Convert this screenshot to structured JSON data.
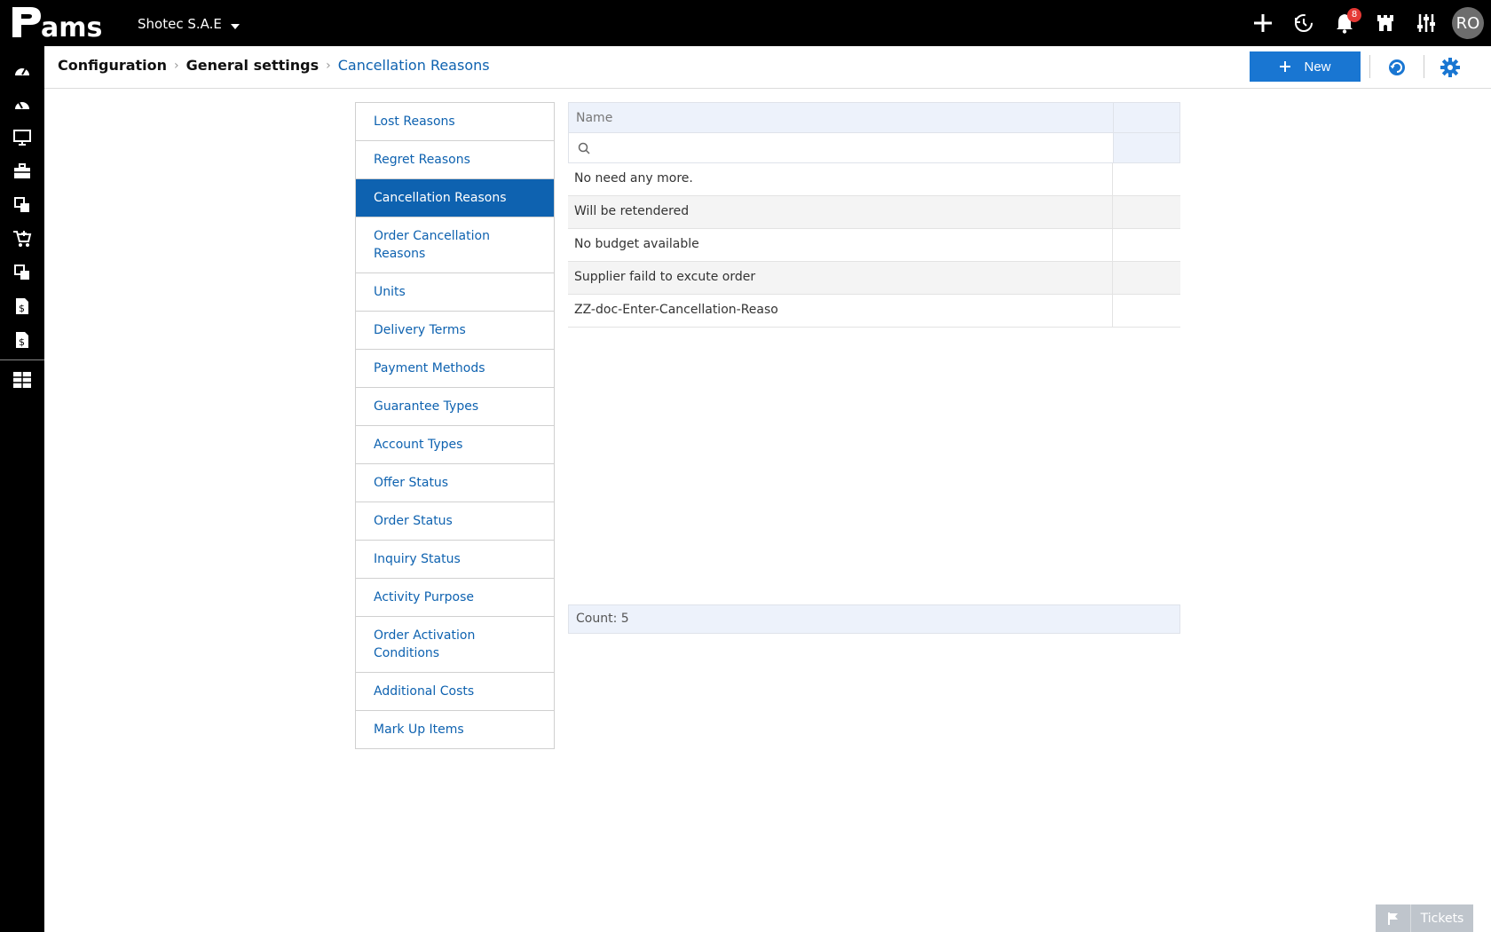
{
  "topbar": {
    "logo_text": "Pams",
    "company": "Shotec S.A.E",
    "notification_count": "8",
    "user_initials": "RO"
  },
  "breadcrumb": {
    "items": [
      "Configuration",
      "General settings",
      "Cancellation Reasons"
    ]
  },
  "toolbar": {
    "new_label": "New"
  },
  "menu": {
    "items": [
      {
        "label": "Lost Reasons"
      },
      {
        "label": "Regret Reasons"
      },
      {
        "label": "Cancellation Reasons",
        "active": true
      },
      {
        "label": "Order Cancellation Reasons"
      },
      {
        "label": "Units"
      },
      {
        "label": "Delivery Terms"
      },
      {
        "label": "Payment Methods"
      },
      {
        "label": "Guarantee Types"
      },
      {
        "label": "Account Types"
      },
      {
        "label": "Offer Status"
      },
      {
        "label": "Order Status"
      },
      {
        "label": "Inquiry Status"
      },
      {
        "label": "Activity Purpose"
      },
      {
        "label": "Order Activation Conditions"
      },
      {
        "label": "Additional Costs"
      },
      {
        "label": "Mark Up Items"
      }
    ]
  },
  "grid": {
    "column_name": "Name",
    "search_placeholder": "",
    "rows": [
      "No need any more.",
      "Will be retendered",
      "No budget available",
      "Supplier faild to excute order",
      "ZZ-doc-Enter-Cancellation-Reaso"
    ],
    "count_text": "Count: 5"
  },
  "tickets": {
    "label": "Tickets"
  },
  "colors": {
    "accent": "#1976d2",
    "active_menu": "#0e62b0",
    "badge": "#e53935"
  }
}
